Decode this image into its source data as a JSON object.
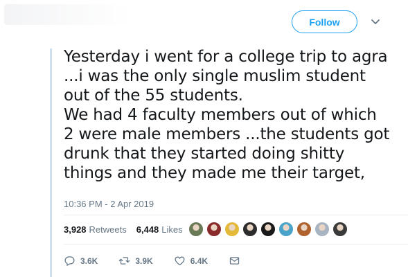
{
  "header": {
    "follow_label": "Follow"
  },
  "tweet": {
    "lines": [
      "Yesterday i went for a college trip to agra",
      "...i was the only single muslim student",
      "out of the 55 students.",
      "We had 4 faculty members out of which",
      "2 were male members ...the students got",
      "drunk that they started doing shitty",
      "things and they made me their target,"
    ],
    "timestamp": "10:36 PM - 2 Apr 2019"
  },
  "stats": {
    "retweets_count": "3,928",
    "retweets_label": "Retweets",
    "likes_count": "6,448",
    "likes_label": "Likes"
  },
  "liker_avatars": [
    {
      "color": "#6b7a56"
    },
    {
      "color": "#8b2a2a"
    },
    {
      "color": "#e4b93a"
    },
    {
      "color": "#2c2c2c"
    },
    {
      "color": "#1a1a1a"
    },
    {
      "color": "#4aa3c8"
    },
    {
      "color": "#b0622e"
    },
    {
      "color": "#a9b4c2"
    },
    {
      "color": "#3a3a3a"
    }
  ],
  "actions": {
    "replies": "3.6K",
    "retweets": "3.9K",
    "likes": "6.4K"
  },
  "icons": {
    "reply": "reply-icon",
    "retweet": "retweet-icon",
    "like": "heart-icon",
    "dm": "envelope-icon",
    "more": "chevron-down-icon"
  },
  "colors": {
    "accent": "#1da1f2",
    "muted": "#657786",
    "text": "#14171a"
  }
}
